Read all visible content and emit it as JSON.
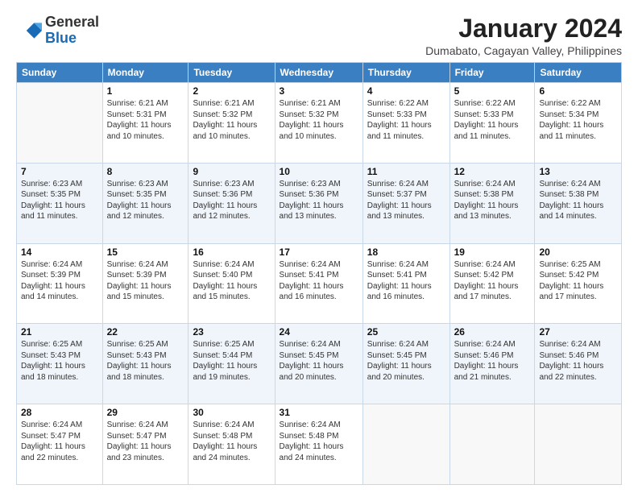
{
  "logo": {
    "general": "General",
    "blue": "Blue"
  },
  "title": "January 2024",
  "location": "Dumabato, Cagayan Valley, Philippines",
  "weekdays": [
    "Sunday",
    "Monday",
    "Tuesday",
    "Wednesday",
    "Thursday",
    "Friday",
    "Saturday"
  ],
  "weeks": [
    [
      {
        "day": "",
        "info": ""
      },
      {
        "day": "1",
        "info": "Sunrise: 6:21 AM\nSunset: 5:31 PM\nDaylight: 11 hours\nand 10 minutes."
      },
      {
        "day": "2",
        "info": "Sunrise: 6:21 AM\nSunset: 5:32 PM\nDaylight: 11 hours\nand 10 minutes."
      },
      {
        "day": "3",
        "info": "Sunrise: 6:21 AM\nSunset: 5:32 PM\nDaylight: 11 hours\nand 10 minutes."
      },
      {
        "day": "4",
        "info": "Sunrise: 6:22 AM\nSunset: 5:33 PM\nDaylight: 11 hours\nand 11 minutes."
      },
      {
        "day": "5",
        "info": "Sunrise: 6:22 AM\nSunset: 5:33 PM\nDaylight: 11 hours\nand 11 minutes."
      },
      {
        "day": "6",
        "info": "Sunrise: 6:22 AM\nSunset: 5:34 PM\nDaylight: 11 hours\nand 11 minutes."
      }
    ],
    [
      {
        "day": "7",
        "info": "Sunrise: 6:23 AM\nSunset: 5:35 PM\nDaylight: 11 hours\nand 11 minutes."
      },
      {
        "day": "8",
        "info": "Sunrise: 6:23 AM\nSunset: 5:35 PM\nDaylight: 11 hours\nand 12 minutes."
      },
      {
        "day": "9",
        "info": "Sunrise: 6:23 AM\nSunset: 5:36 PM\nDaylight: 11 hours\nand 12 minutes."
      },
      {
        "day": "10",
        "info": "Sunrise: 6:23 AM\nSunset: 5:36 PM\nDaylight: 11 hours\nand 13 minutes."
      },
      {
        "day": "11",
        "info": "Sunrise: 6:24 AM\nSunset: 5:37 PM\nDaylight: 11 hours\nand 13 minutes."
      },
      {
        "day": "12",
        "info": "Sunrise: 6:24 AM\nSunset: 5:38 PM\nDaylight: 11 hours\nand 13 minutes."
      },
      {
        "day": "13",
        "info": "Sunrise: 6:24 AM\nSunset: 5:38 PM\nDaylight: 11 hours\nand 14 minutes."
      }
    ],
    [
      {
        "day": "14",
        "info": "Sunrise: 6:24 AM\nSunset: 5:39 PM\nDaylight: 11 hours\nand 14 minutes."
      },
      {
        "day": "15",
        "info": "Sunrise: 6:24 AM\nSunset: 5:39 PM\nDaylight: 11 hours\nand 15 minutes."
      },
      {
        "day": "16",
        "info": "Sunrise: 6:24 AM\nSunset: 5:40 PM\nDaylight: 11 hours\nand 15 minutes."
      },
      {
        "day": "17",
        "info": "Sunrise: 6:24 AM\nSunset: 5:41 PM\nDaylight: 11 hours\nand 16 minutes."
      },
      {
        "day": "18",
        "info": "Sunrise: 6:24 AM\nSunset: 5:41 PM\nDaylight: 11 hours\nand 16 minutes."
      },
      {
        "day": "19",
        "info": "Sunrise: 6:24 AM\nSunset: 5:42 PM\nDaylight: 11 hours\nand 17 minutes."
      },
      {
        "day": "20",
        "info": "Sunrise: 6:25 AM\nSunset: 5:42 PM\nDaylight: 11 hours\nand 17 minutes."
      }
    ],
    [
      {
        "day": "21",
        "info": "Sunrise: 6:25 AM\nSunset: 5:43 PM\nDaylight: 11 hours\nand 18 minutes."
      },
      {
        "day": "22",
        "info": "Sunrise: 6:25 AM\nSunset: 5:43 PM\nDaylight: 11 hours\nand 18 minutes."
      },
      {
        "day": "23",
        "info": "Sunrise: 6:25 AM\nSunset: 5:44 PM\nDaylight: 11 hours\nand 19 minutes."
      },
      {
        "day": "24",
        "info": "Sunrise: 6:24 AM\nSunset: 5:45 PM\nDaylight: 11 hours\nand 20 minutes."
      },
      {
        "day": "25",
        "info": "Sunrise: 6:24 AM\nSunset: 5:45 PM\nDaylight: 11 hours\nand 20 minutes."
      },
      {
        "day": "26",
        "info": "Sunrise: 6:24 AM\nSunset: 5:46 PM\nDaylight: 11 hours\nand 21 minutes."
      },
      {
        "day": "27",
        "info": "Sunrise: 6:24 AM\nSunset: 5:46 PM\nDaylight: 11 hours\nand 22 minutes."
      }
    ],
    [
      {
        "day": "28",
        "info": "Sunrise: 6:24 AM\nSunset: 5:47 PM\nDaylight: 11 hours\nand 22 minutes."
      },
      {
        "day": "29",
        "info": "Sunrise: 6:24 AM\nSunset: 5:47 PM\nDaylight: 11 hours\nand 23 minutes."
      },
      {
        "day": "30",
        "info": "Sunrise: 6:24 AM\nSunset: 5:48 PM\nDaylight: 11 hours\nand 24 minutes."
      },
      {
        "day": "31",
        "info": "Sunrise: 6:24 AM\nSunset: 5:48 PM\nDaylight: 11 hours\nand 24 minutes."
      },
      {
        "day": "",
        "info": ""
      },
      {
        "day": "",
        "info": ""
      },
      {
        "day": "",
        "info": ""
      }
    ]
  ]
}
